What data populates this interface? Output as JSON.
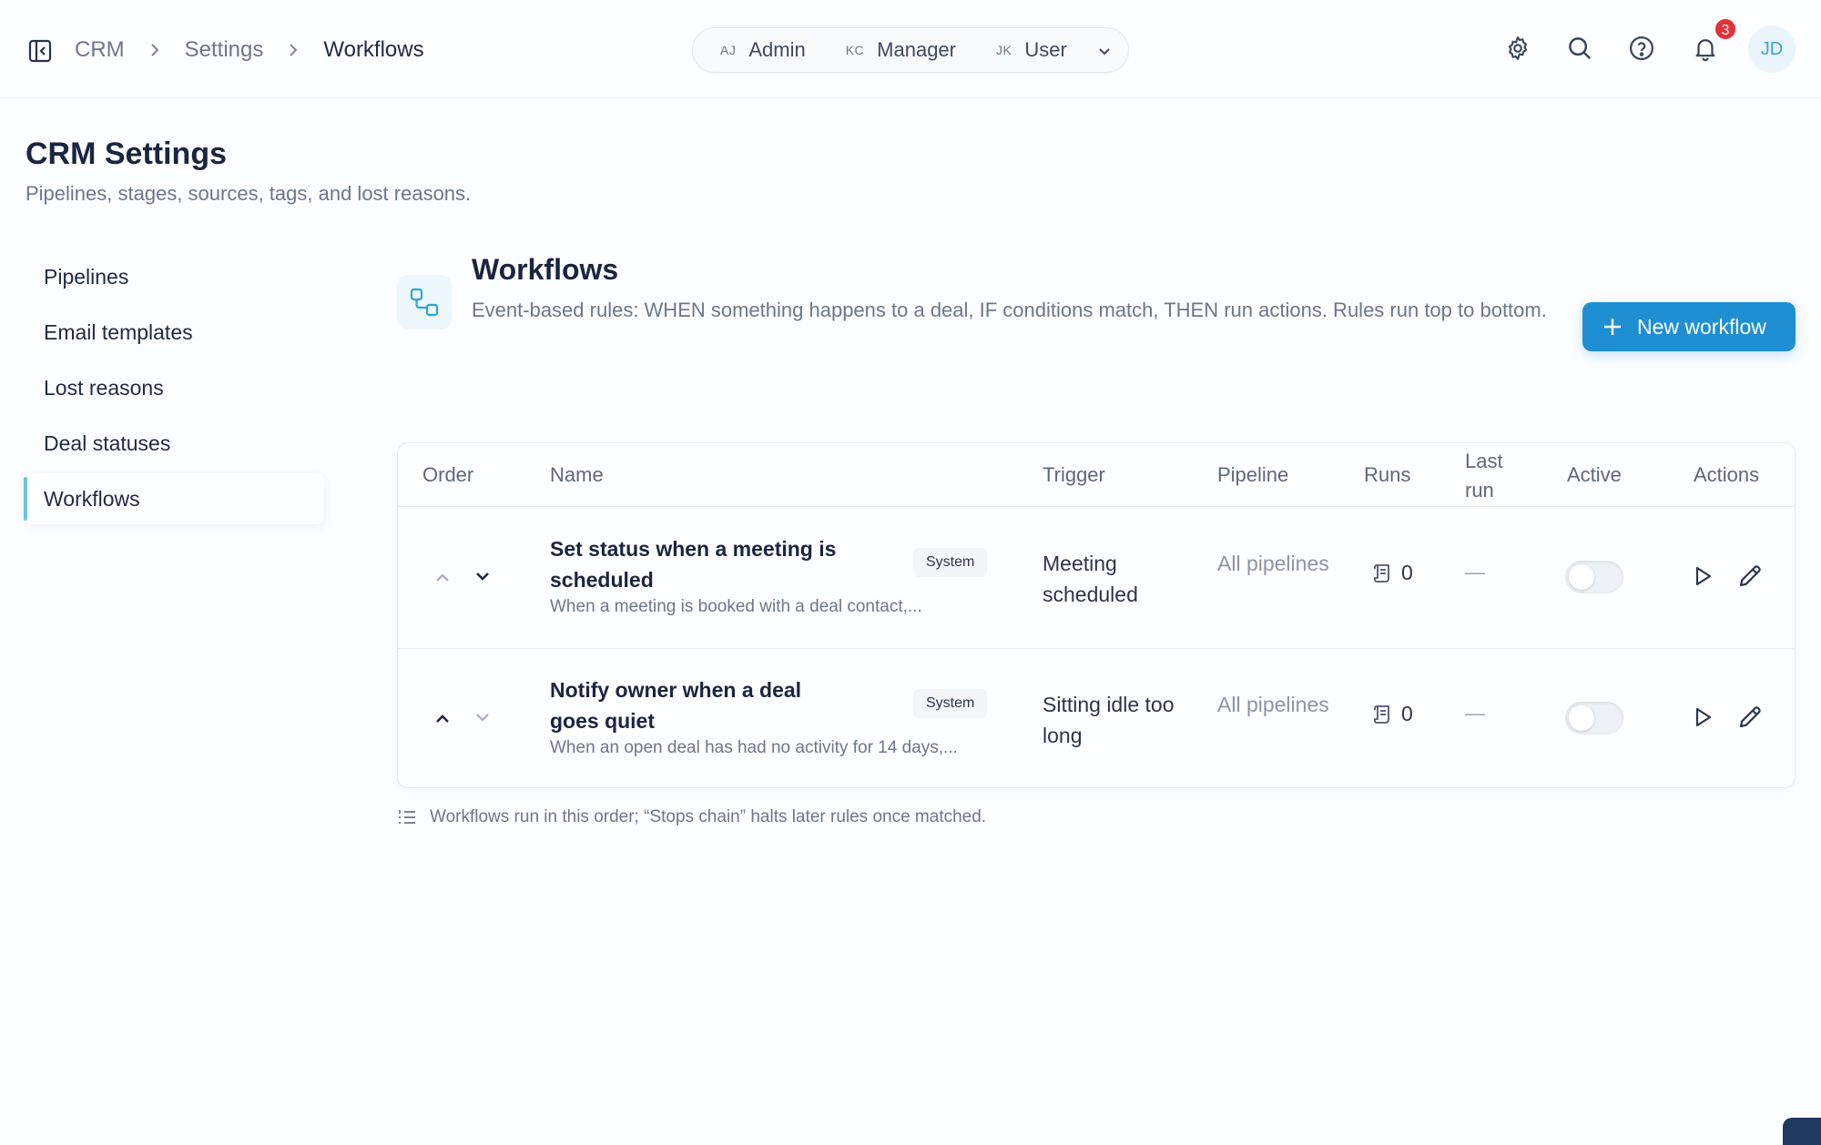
{
  "breadcrumb": [
    "CRM",
    "Settings",
    "Workflows"
  ],
  "roles": [
    {
      "initials": "AJ",
      "name": "Admin"
    },
    {
      "initials": "KC",
      "name": "Manager"
    },
    {
      "initials": "JK",
      "name": "User"
    }
  ],
  "header_icons": [
    "gear-icon",
    "search-icon",
    "help-icon",
    "bell-icon"
  ],
  "notifications_count": "3",
  "avatar_initials": "JD",
  "page": {
    "title": "CRM Settings",
    "subtitle": "Pipelines, stages, sources, tags, and lost reasons."
  },
  "nav": {
    "items": [
      "Pipelines",
      "Email templates",
      "Lost reasons",
      "Deal statuses",
      "Workflows"
    ],
    "active": "Workflows"
  },
  "section": {
    "title": "Workflows",
    "description": "Event-based rules: WHEN something happens to a deal, IF conditions match, THEN run actions. Rules run top to bottom.",
    "new_button": "New workflow"
  },
  "table": {
    "headers": {
      "order": "Order",
      "name": "Name",
      "trigger": "Trigger",
      "pipeline": "Pipeline",
      "runs": "Runs",
      "last_run": "Last run",
      "active": "Active",
      "actions": "Actions"
    },
    "rows": [
      {
        "name": "Set status when a meeting is scheduled",
        "badge": "System",
        "description": "When a meeting is booked with a deal contact,...",
        "trigger": "Meeting scheduled",
        "pipeline": "All pipelines",
        "runs": "0",
        "last_run": "—",
        "active": false
      },
      {
        "name": "Notify owner when a deal goes quiet",
        "badge": "System",
        "description": "When an open deal has had no activity for 14 days,...",
        "trigger": "Sitting idle too long",
        "pipeline": "All pipelines",
        "runs": "0",
        "last_run": "—",
        "active": false
      }
    ]
  },
  "footnote": "Workflows run in this order; “Stops chain” halts later rules once matched.",
  "colors": {
    "accent": "#1f8fd4",
    "active_nav_marker": "#6cc4e6",
    "badge_red": "#e3303a"
  }
}
